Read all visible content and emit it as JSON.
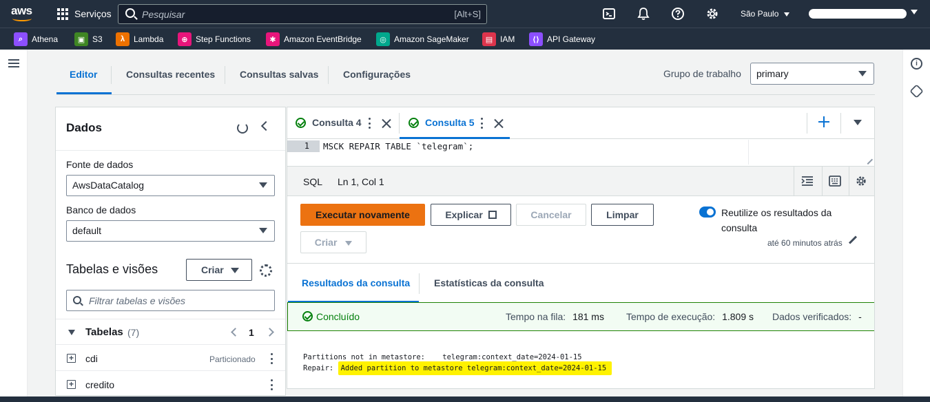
{
  "topbar": {
    "logo": "aws",
    "services_label": "Serviços",
    "search_placeholder": "Pesquisar",
    "search_shortcut": "[Alt+S]",
    "region": "São Paulo"
  },
  "favorites": [
    {
      "label": "Athena",
      "icon": "athena-icon",
      "color": "#8c4fff"
    },
    {
      "label": "S3",
      "icon": "s3-icon",
      "color": "#3f8624"
    },
    {
      "label": "Lambda",
      "icon": "lambda-icon",
      "color": "#ed7100"
    },
    {
      "label": "Step Functions",
      "icon": "step-functions-icon",
      "color": "#e7157b"
    },
    {
      "label": "Amazon EventBridge",
      "icon": "eventbridge-icon",
      "color": "#e7157b"
    },
    {
      "label": "Amazon SageMaker",
      "icon": "sagemaker-icon",
      "color": "#01a88d"
    },
    {
      "label": "IAM",
      "icon": "iam-icon",
      "color": "#dd344c"
    },
    {
      "label": "API Gateway",
      "icon": "api-gateway-icon",
      "color": "#8c4fff"
    }
  ],
  "main_tabs": [
    "Editor",
    "Consultas recentes",
    "Consultas salvas",
    "Configurações"
  ],
  "workgroup": {
    "label": "Grupo de trabalho",
    "value": "primary"
  },
  "data_panel": {
    "title": "Dados",
    "source_label": "Fonte de dados",
    "source_value": "AwsDataCatalog",
    "db_label": "Banco de dados",
    "db_value": "default",
    "tables_views_title": "Tabelas e visões",
    "create_label": "Criar",
    "filter_placeholder": "Filtrar tabelas e visões",
    "tables_label": "Tabelas",
    "tables_count": "(7)",
    "page": "1",
    "tables": [
      {
        "name": "cdi",
        "tag": "Particionado"
      },
      {
        "name": "credito",
        "tag": ""
      }
    ]
  },
  "query_tabs": [
    {
      "label": "Consulta 4",
      "active": false
    },
    {
      "label": "Consulta 5",
      "active": true
    }
  ],
  "editor": {
    "line_number": "1",
    "code": "MSCK REPAIR TABLE `telegram`;",
    "language": "SQL",
    "cursor": "Ln 1, Col 1"
  },
  "actions": {
    "run_again": "Executar novamente",
    "explain": "Explicar",
    "cancel": "Cancelar",
    "clear": "Limpar",
    "create": "Criar",
    "reuse_label": "Reutilize os resultados da consulta",
    "reuse_sub": "até 60 minutos atrás"
  },
  "result_tabs": [
    "Resultados da consulta",
    "Estatísticas da consulta"
  ],
  "result_status": {
    "status": "Concluído",
    "queue_label": "Tempo na fila:",
    "queue_value": "181 ms",
    "exec_label": "Tempo de execução:",
    "exec_value": "1.809 s",
    "scanned_label": "Dados verificados:",
    "scanned_value": "-"
  },
  "output": {
    "line1": "Partitions not in metastore:    telegram:context_date=2024-01-15",
    "line2_prefix": "Repair: ",
    "line2_highlight": "Added partition to metastore telegram:context_date=2024-01-15"
  },
  "colors": {
    "accent": "#0972d3",
    "primary_button": "#ec7211",
    "success": "#037f0c",
    "highlight": "#fff200",
    "nav_bg": "#232f3e"
  }
}
